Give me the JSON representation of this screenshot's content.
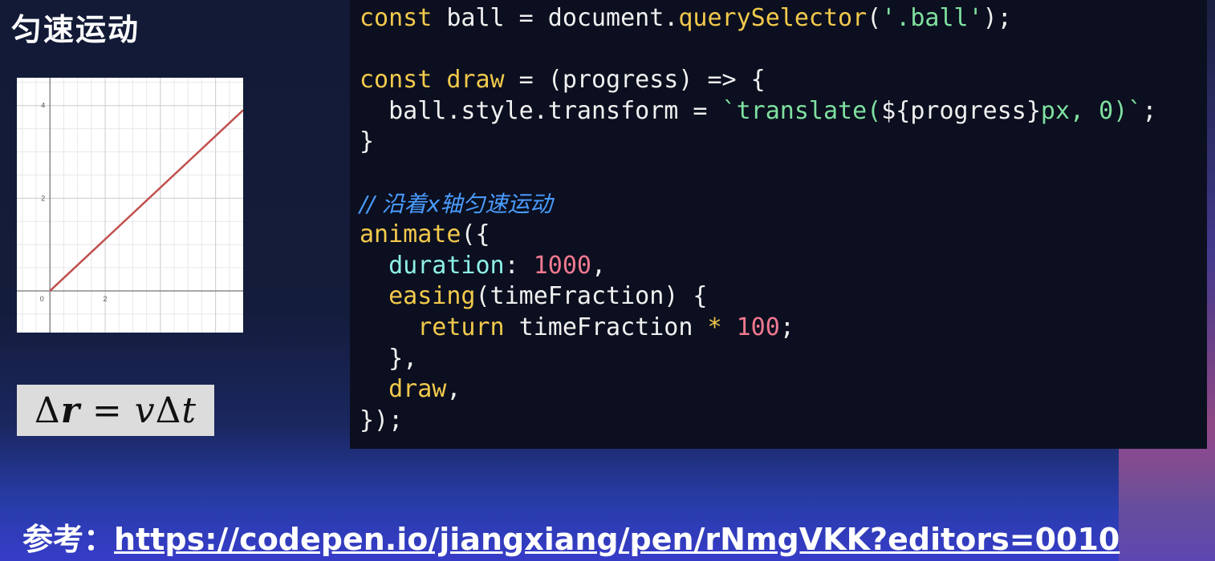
{
  "slide": {
    "title": "匀速运动",
    "reference_label": "参考：",
    "reference_url": "https://codepen.io/jiangxiang/pen/rNmgVKK?editors=0010"
  },
  "formula": {
    "delta1": "Δ",
    "r": "r",
    "equals": " = ",
    "v": "v",
    "delta2": "Δ",
    "t": "t"
  },
  "chart_data": {
    "type": "line",
    "x_ticks": [
      "0",
      "2"
    ],
    "y_ticks": [
      "2",
      "4"
    ],
    "xlim": [
      -1.2,
      7
    ],
    "ylim": [
      -0.9,
      4.6
    ],
    "series": [
      {
        "color": "#c0504d",
        "x": [
          0,
          7
        ],
        "y": [
          0,
          3.9
        ]
      }
    ],
    "grid": true
  },
  "code": {
    "line1": {
      "kw": "const",
      "a": " ball = document.",
      "fn": "querySelector",
      "b": "(",
      "str": "'.ball'",
      "c": ");"
    },
    "line3": {
      "kw": "const",
      "a": " ",
      "fn": "draw",
      "b": " = (progress) => {"
    },
    "line4": {
      "a": "  ball.style.transform = ",
      "str1": "`translate(",
      "var": "${progress}",
      "str2": "px, 0)`",
      "b": ";"
    },
    "line5": "}",
    "line7": "// 沿着x轴匀速运动",
    "line8": {
      "fn": "animate",
      "a": "({"
    },
    "line9": {
      "prop": "  duration",
      "a": ": ",
      "num": "1000",
      "b": ","
    },
    "line10": {
      "fn": "  easing",
      "a": "(timeFraction) {"
    },
    "line11": {
      "kw": "    return",
      "a": " timeFraction ",
      "op": "*",
      "b": " ",
      "num": "100",
      "c": ";"
    },
    "line12": "  },",
    "line13": {
      "fn": "  draw",
      "a": ","
    },
    "line14": "});"
  },
  "colors": {
    "keyword": "#f2c94c",
    "string": "#7fe0a0",
    "number": "#f07890",
    "property": "#8ef0e6",
    "comment": "#4a9cff",
    "line": "#c0504d"
  }
}
